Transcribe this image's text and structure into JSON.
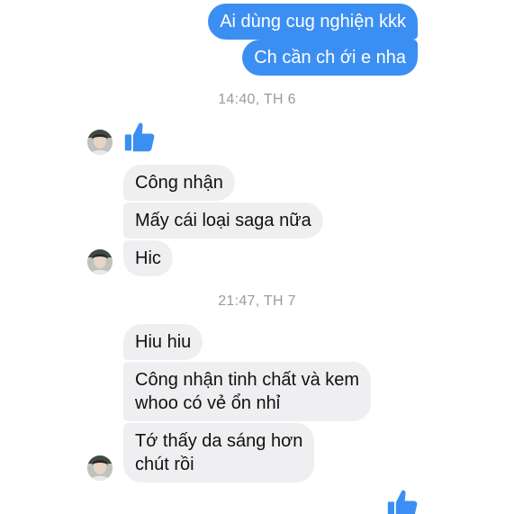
{
  "outgoing": [
    {
      "text": "Ai dùng cug nghiện kkk"
    },
    {
      "text": "Ch cần ch ới e nha"
    }
  ],
  "timestamps": {
    "first": "14:40, TH 6",
    "second": "21:47, TH 7"
  },
  "incoming_group1": [
    {
      "text": "Công nhận"
    },
    {
      "text": "Mấy cái loại saga nữa"
    },
    {
      "text": "Hic"
    }
  ],
  "incoming_group2": [
    {
      "text": "Hiu hiu"
    },
    {
      "text": "Công nhận tinh chất và kem\nwhoo có vẻ ổn nhỉ"
    },
    {
      "text": "Tớ thấy da sáng hơn\nchút rồi"
    }
  ],
  "icons": {
    "like": "thumbs-up-icon",
    "avatar": "contact-avatar"
  },
  "colors": {
    "outgoing_bubble": "#3c8ff2",
    "incoming_bubble": "#efeff1",
    "like": "#3c8ff2",
    "timestamp": "#9a9aa0"
  }
}
